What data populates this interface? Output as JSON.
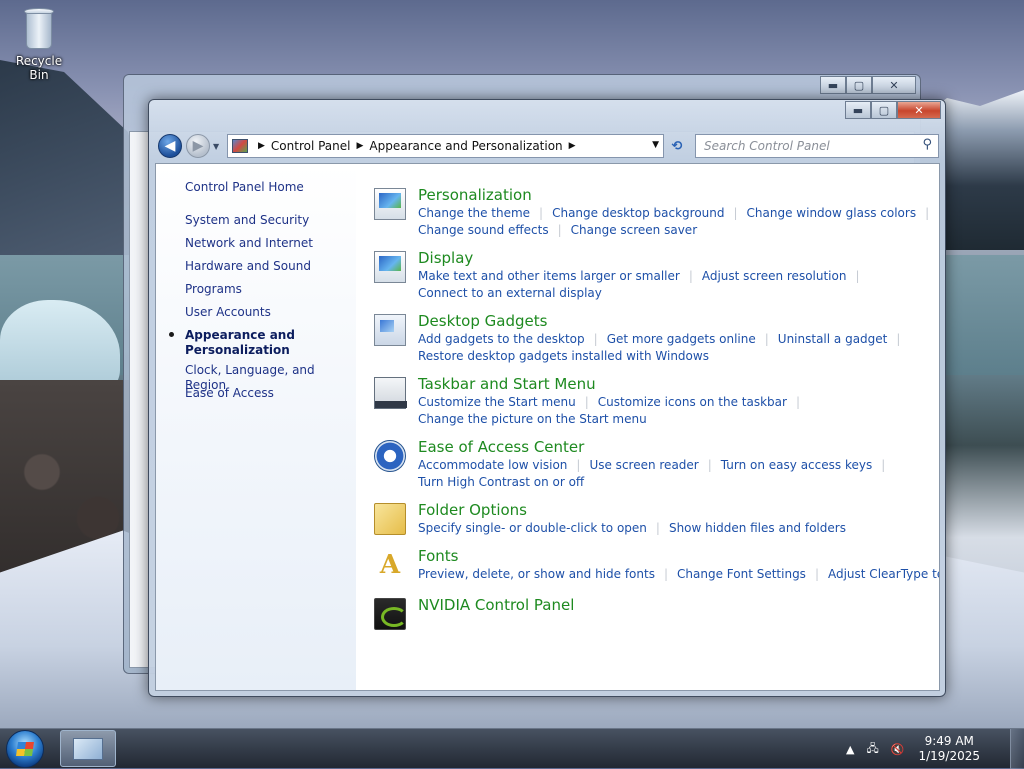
{
  "desktop": {
    "recycle_bin_label": "Recycle Bin"
  },
  "window": {
    "address": {
      "crumbs": [
        "Control Panel",
        "Appearance and Personalization"
      ]
    },
    "search_placeholder": "Search Control Panel",
    "left_pane": {
      "home": "Control Panel Home",
      "items": [
        "System and Security",
        "Network and Internet",
        "Hardware and Sound",
        "Programs",
        "User Accounts",
        "Appearance and",
        "Personalization",
        "Clock, Language, and Region",
        "Ease of Access"
      ],
      "active_item": "Appearance and Personalization"
    },
    "categories": [
      {
        "title": "Personalization",
        "icon": "monitor-icon",
        "links": [
          [
            "Change the theme",
            "Change desktop background",
            "Change window glass colors"
          ],
          [
            "Change sound effects",
            "Change screen saver"
          ]
        ]
      },
      {
        "title": "Display",
        "icon": "display-icon",
        "links": [
          [
            "Make text and other items larger or smaller",
            "Adjust screen resolution"
          ],
          [
            "Connect to an external display"
          ]
        ]
      },
      {
        "title": "Desktop Gadgets",
        "icon": "gadgets-icon",
        "links": [
          [
            "Add gadgets to the desktop",
            "Get more gadgets online",
            "Uninstall a gadget"
          ],
          [
            "Restore desktop gadgets installed with Windows"
          ]
        ]
      },
      {
        "title": "Taskbar and Start Menu",
        "icon": "taskbar-icon",
        "links": [
          [
            "Customize the Start menu",
            "Customize icons on the taskbar"
          ],
          [
            "Change the picture on the Start menu"
          ]
        ]
      },
      {
        "title": "Ease of Access Center",
        "icon": "ease-of-access-icon",
        "links": [
          [
            "Accommodate low vision",
            "Use screen reader",
            "Turn on easy access keys"
          ],
          [
            "Turn High Contrast on or off"
          ]
        ]
      },
      {
        "title": "Folder Options",
        "icon": "folder-icon",
        "links": [
          [
            "Specify single- or double-click to open",
            "Show hidden files and folders"
          ]
        ]
      },
      {
        "title": "Fonts",
        "icon": "fonts-icon",
        "links": [
          [
            "Preview, delete, or show and hide fonts",
            "Change Font Settings",
            "Adjust ClearType text"
          ]
        ]
      },
      {
        "title": "NVIDIA Control Panel",
        "icon": "nvidia-icon",
        "links": []
      }
    ]
  },
  "taskbar": {
    "time": "9:49 AM",
    "date": "1/19/2025"
  },
  "colors": {
    "category_title": "#1e8a20",
    "link": "#1e50a8",
    "nav_link": "#1e3287"
  }
}
